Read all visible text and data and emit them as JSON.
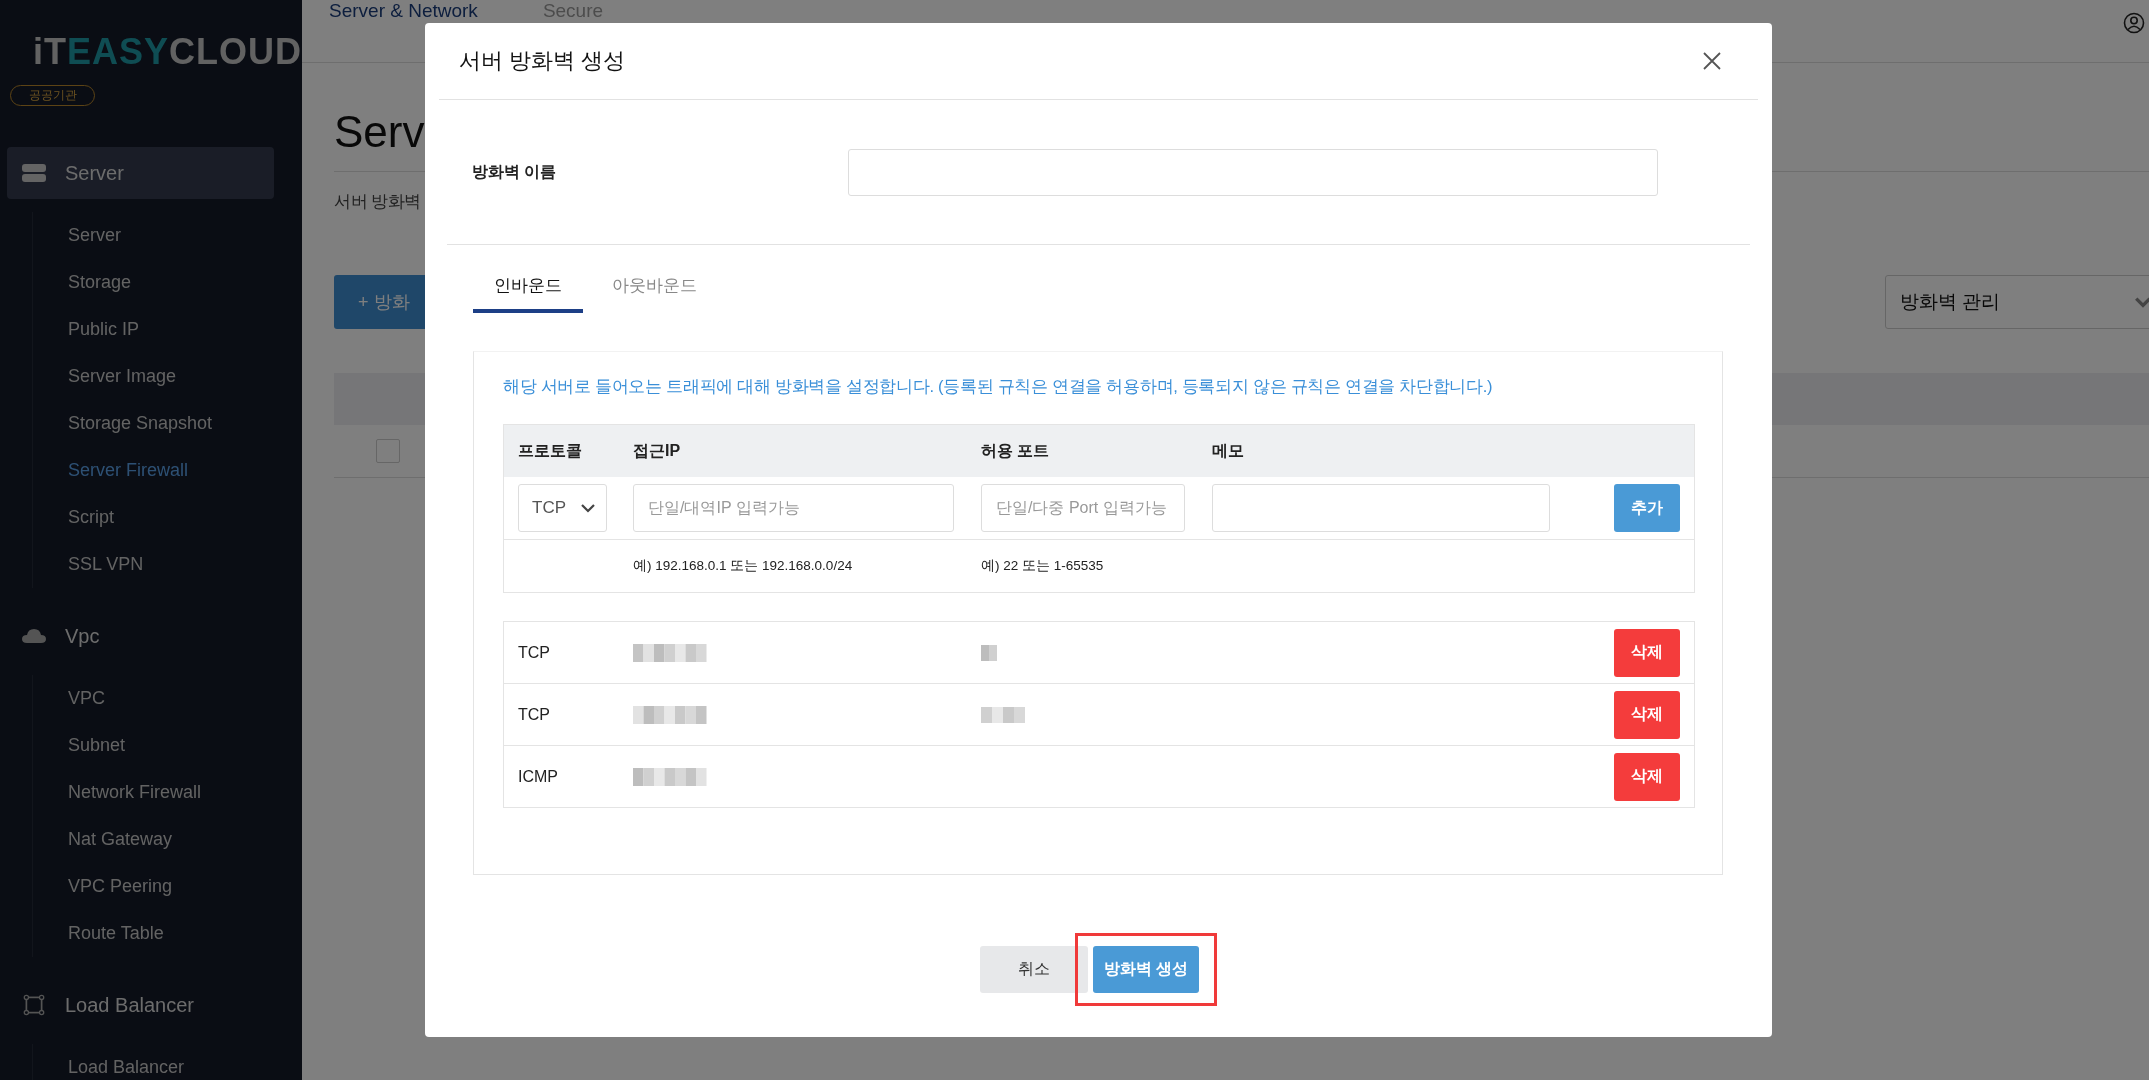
{
  "sidebar": {
    "logo": [
      "iT",
      "EASY",
      "CLOUD"
    ],
    "badge": "공공기관",
    "sections": [
      {
        "label": "Server",
        "selected": true,
        "items": [
          {
            "label": "Server",
            "selected": false
          },
          {
            "label": "Storage",
            "selected": false
          },
          {
            "label": "Public IP",
            "selected": false
          },
          {
            "label": "Server Image",
            "selected": false
          },
          {
            "label": "Storage Snapshot",
            "selected": false
          },
          {
            "label": "Server Firewall",
            "selected": true
          },
          {
            "label": "Script",
            "selected": false
          },
          {
            "label": "SSL VPN",
            "selected": false
          }
        ]
      },
      {
        "label": "Vpc",
        "selected": false,
        "items": [
          {
            "label": "VPC",
            "selected": false
          },
          {
            "label": "Subnet",
            "selected": false
          },
          {
            "label": "Network Firewall",
            "selected": false
          },
          {
            "label": "Nat Gateway",
            "selected": false
          },
          {
            "label": "VPC Peering",
            "selected": false
          },
          {
            "label": "Route Table",
            "selected": false
          }
        ]
      },
      {
        "label": "Load Balancer",
        "selected": false,
        "items": [
          {
            "label": "Load Balancer",
            "selected": false
          }
        ]
      }
    ]
  },
  "background": {
    "header_tabs": [
      {
        "label": "Server & Network",
        "selected": true
      },
      {
        "label": "Secure",
        "selected": false
      }
    ],
    "title": "Serv",
    "subtitle": "서버 방화벽",
    "create_button": "+ 방화",
    "dropdown": "방화벽 관리",
    "table_rows": [
      {
        "checked": false
      }
    ]
  },
  "modal": {
    "title": "서버 방화벽 생성",
    "name_label": "방화벽 이름",
    "tabs": [
      {
        "label": "인바운드",
        "selected": true
      },
      {
        "label": "아웃바운드",
        "selected": false
      }
    ],
    "info": "해당 서버로 들어오는 트래픽에 대해 방화벽을 설정합니다. (등록된 규칙은 연결을 허용하며, 등록되지 않은 규칙은 연결을 차단합니다.)",
    "columns": [
      "프로토콜",
      "접근IP",
      "허용 포트",
      "메모"
    ],
    "protocol": "TCP",
    "ip_placeholder": "단일/대역IP 입력가능",
    "port_placeholder": "단일/다중 Port 입력가능",
    "add_button": "추가",
    "examples": [
      "예) 192.168.0.1 또는 192.168.0.0/24",
      "예) 22 또는 1-65535"
    ],
    "rules": [
      {
        "protocol": "TCP",
        "ip_redacted": true,
        "port_redacted": true,
        "delete_button": "삭제"
      },
      {
        "protocol": "TCP",
        "ip_redacted": true,
        "port_redacted": true,
        "delete_button": "삭제"
      },
      {
        "protocol": "ICMP",
        "ip_redacted": true,
        "port_redacted": false,
        "delete_button": "삭제"
      }
    ],
    "cancel_button": "취소",
    "create_button": {
      "label": "방화벽 생성",
      "highlighted": true
    }
  }
}
